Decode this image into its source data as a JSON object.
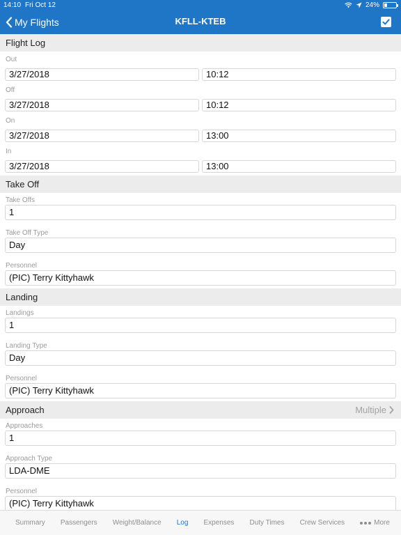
{
  "status": {
    "time": "14:10",
    "date": "Fri Oct 12",
    "battery": "24%"
  },
  "nav": {
    "back_label": "My Flights",
    "title": "KFLL-KTEB"
  },
  "flight_log": {
    "header": "Flight Log",
    "out_label": "Out",
    "out_date": "3/27/2018",
    "out_time": "10:12",
    "off_label": "Off",
    "off_date": "3/27/2018",
    "off_time": "10:12",
    "on_label": "On",
    "on_date": "3/27/2018",
    "on_time": "13:00",
    "in_label": "In",
    "in_date": "3/27/2018",
    "in_time": "13:00"
  },
  "take_off": {
    "header": "Take Off",
    "count_label": "Take Offs",
    "count_value": "1",
    "type_label": "Take Off Type",
    "type_value": "Day",
    "personnel_label": "Personnel",
    "personnel_value": "(PIC) Terry Kittyhawk"
  },
  "landing": {
    "header": "Landing",
    "count_label": "Landings",
    "count_value": "1",
    "type_label": "Landing Type",
    "type_value": "Day",
    "personnel_label": "Personnel",
    "personnel_value": "(PIC) Terry Kittyhawk"
  },
  "approach": {
    "header": "Approach",
    "multiple_label": "Multiple",
    "count_label": "Approaches",
    "count_value": "1",
    "type_label": "Approach Type",
    "type_value": "LDA-DME",
    "personnel_label": "Personnel",
    "personnel_value": "(PIC) Terry Kittyhawk"
  },
  "tabs": {
    "summary": "Summary",
    "passengers": "Passengers",
    "weight_balance": "Weight/Balance",
    "log": "Log",
    "expenses": "Expenses",
    "duty_times": "Duty Times",
    "crew_services": "Crew Services",
    "more": "More"
  },
  "colors": {
    "accent": "#1f76c6",
    "section_bg": "#ececec"
  }
}
